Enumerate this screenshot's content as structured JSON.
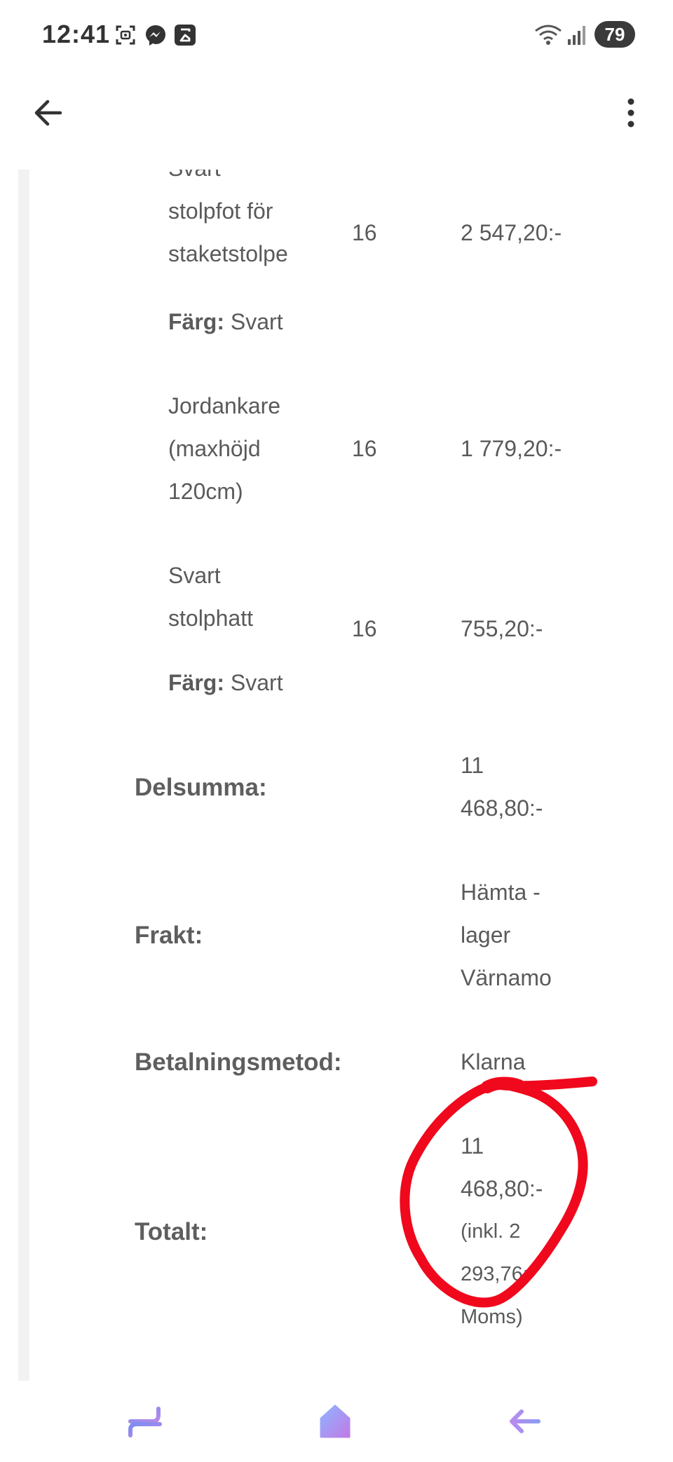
{
  "status_bar": {
    "time": "12:41",
    "icons": [
      "screenshot-icon",
      "messenger-icon",
      "sigma-icon",
      "wifi-icon",
      "signal-icon"
    ],
    "battery": "79"
  },
  "app_bar": {
    "back_icon": "arrow-left-icon",
    "menu_icon": "more-vertical-icon"
  },
  "order": {
    "items": [
      {
        "name_lines": [
          "Svart",
          "stolpfot för",
          "staketstolpe"
        ],
        "qty": "16",
        "price": "2 547,20:-",
        "attr_label": "Färg:",
        "attr_value": "Svart"
      },
      {
        "name_lines": [
          "Jordankare",
          "(maxhöjd",
          "120cm)"
        ],
        "qty": "16",
        "price": "1 779,20:-"
      },
      {
        "name_lines": [
          "Svart",
          "stolphatt"
        ],
        "qty": "16",
        "price": "755,20:-",
        "attr_label": "Färg:",
        "attr_value": "Svart"
      }
    ],
    "subtotal": {
      "label": "Delsumma:",
      "value_lines": [
        "11",
        "468,80:-"
      ]
    },
    "shipping": {
      "label": "Frakt:",
      "value_lines": [
        "Hämta -",
        "lager",
        "Värnamo"
      ]
    },
    "payment": {
      "label": "Betalningsmetod:",
      "value": "Klarna"
    },
    "total": {
      "label": "Totalt:",
      "value_lines": [
        "11",
        "468,80:-"
      ],
      "tax_lines": [
        "(inkl. 2",
        "293,76:-",
        "Moms)"
      ]
    }
  },
  "annotation": {
    "color": "#f0081c"
  },
  "nav_bar": {
    "icons": [
      "recent-apps-icon",
      "home-icon",
      "back-nav-icon"
    ]
  }
}
